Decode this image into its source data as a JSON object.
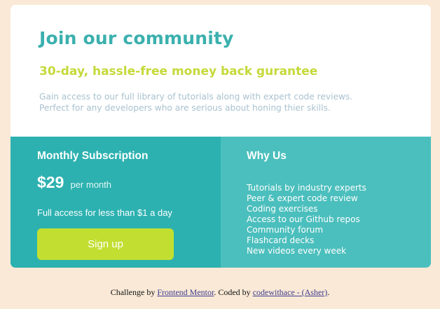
{
  "header": {
    "title": "Join our community",
    "subtitle": "30-day, hassle-free money back gurantee",
    "description_lines": [
      "Gain access to our full library of tutorials along with expert code reviews.",
      "Perfect for any developers who are serious about honing thier skills."
    ]
  },
  "subscription": {
    "title": "Monthly Subscription",
    "price": "$29",
    "period": "per month",
    "tagline": "Full access for less than $1 a day",
    "signup_label": "Sign up"
  },
  "why_us": {
    "title": "Why Us",
    "items": [
      "Tutorials by industry experts",
      "Peer & expert code review",
      "Coding exercises",
      "Access to our Github repos",
      "Community forum",
      "Flashcard decks",
      "New videos every week"
    ]
  },
  "attribution": {
    "prefix": "Challenge by ",
    "link1": "Frontend Mentor",
    "middle": ". Coded by ",
    "link2": "codewithace - (Asher)",
    "suffix": "."
  },
  "colors": {
    "background": "#f9e9d6",
    "title": "#3bb0ae",
    "subtitle": "#c5d93a",
    "description": "#a9c2cf",
    "subscription_panel": "#2cb1b0",
    "why_panel": "#4bbfbd",
    "signup_button": "#c2df31"
  }
}
